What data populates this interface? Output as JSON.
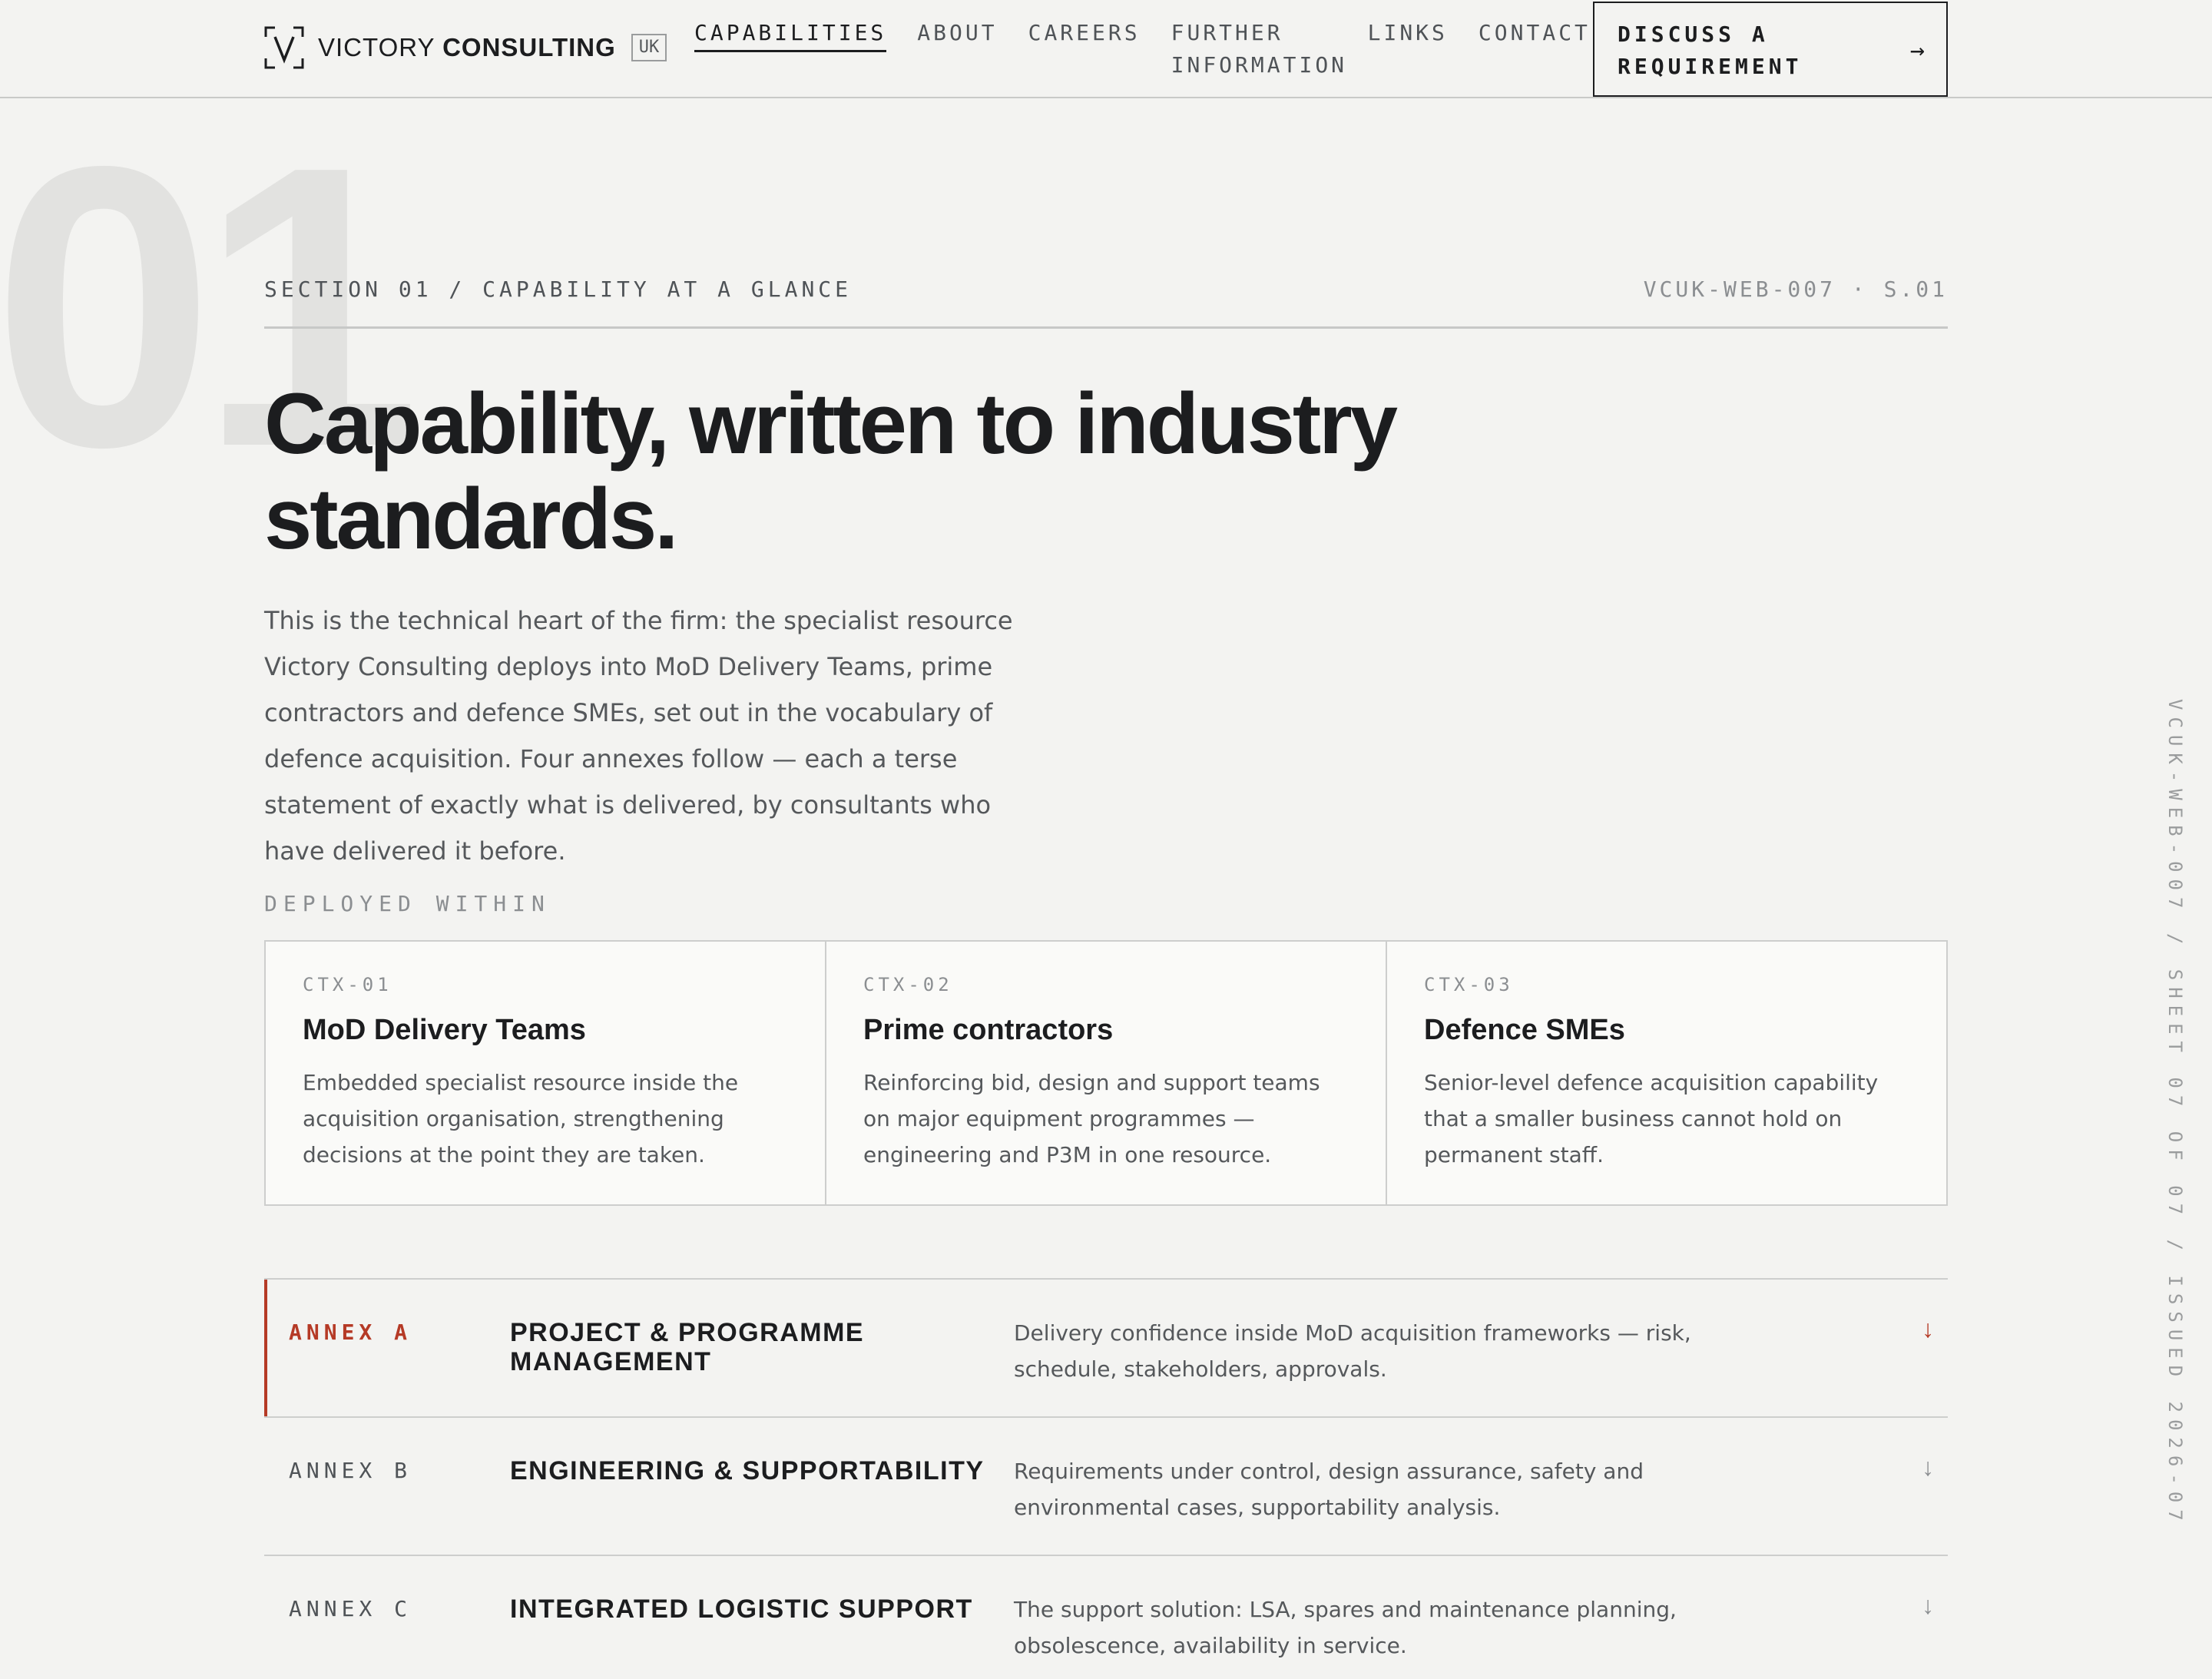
{
  "header": {
    "logo": {
      "brand_light": "VICTORY",
      "brand_bold": "CONSULTING",
      "region": "UK"
    },
    "nav": [
      {
        "label": "CAPABILITIES",
        "active": true
      },
      {
        "label": "ABOUT"
      },
      {
        "label": "CAREERS"
      },
      {
        "label": "FURTHER INFORMATION"
      },
      {
        "label": "LINKS"
      },
      {
        "label": "CONTACT"
      }
    ],
    "cta": {
      "label": "DISCUSS A REQUIREMENT",
      "icon": "arrow-right-icon"
    }
  },
  "section": {
    "number": "01",
    "label": "SECTION 01 / CAPABILITY AT A GLANCE",
    "code": "VCUK-WEB-007 · S.01"
  },
  "hero": {
    "title": "Capability, written to industry standards.",
    "intro": "This is the technical heart of the firm: the specialist resource Victory Consulting deploys into MoD Delivery Teams, prime contractors and defence SMEs, set out in the vocabulary of defence acquisition. Four annexes follow — each a terse statement of exactly what is delivered, by consultants who have delivered it before."
  },
  "deployed": {
    "label": "DEPLOYED WITHIN",
    "cards": [
      {
        "code": "CTX-01",
        "title": "MoD Delivery Teams",
        "desc": "Embedded specialist resource inside the acquisition organisation, strengthening decisions at the point they are taken."
      },
      {
        "code": "CTX-02",
        "title": "Prime contractors",
        "desc": "Reinforcing bid, design and support teams on major equipment programmes — engineering and P3M in one resource."
      },
      {
        "code": "CTX-03",
        "title": "Defence SMEs",
        "desc": "Senior-level defence acquisition capability that a smaller business cannot hold on permanent staff."
      }
    ]
  },
  "annexes": [
    {
      "code": "ANNEX A",
      "name": "PROJECT & PROGRAMME MANAGEMENT",
      "desc": "Delivery confidence inside MoD acquisition frameworks — risk, schedule, stakeholders, approvals.",
      "arrow": "↓",
      "active": true
    },
    {
      "code": "ANNEX B",
      "name": "ENGINEERING & SUPPORTABILITY",
      "desc": "Requirements under control, design assurance, safety and environmental cases, supportability analysis.",
      "arrow": "↓"
    },
    {
      "code": "ANNEX C",
      "name": "INTEGRATED LOGISTIC SUPPORT",
      "desc": "The support solution: LSA, spares and maintenance planning, obsolescence, availability in service.",
      "arrow": "↓"
    }
  ],
  "side_meta": "VCUK-WEB-007 / SHEET 07 OF 07 / ISSUED 2026-07",
  "colors": {
    "accent": "#b53a26",
    "background": "#f3f3f1",
    "ink": "#1c1d1f"
  }
}
